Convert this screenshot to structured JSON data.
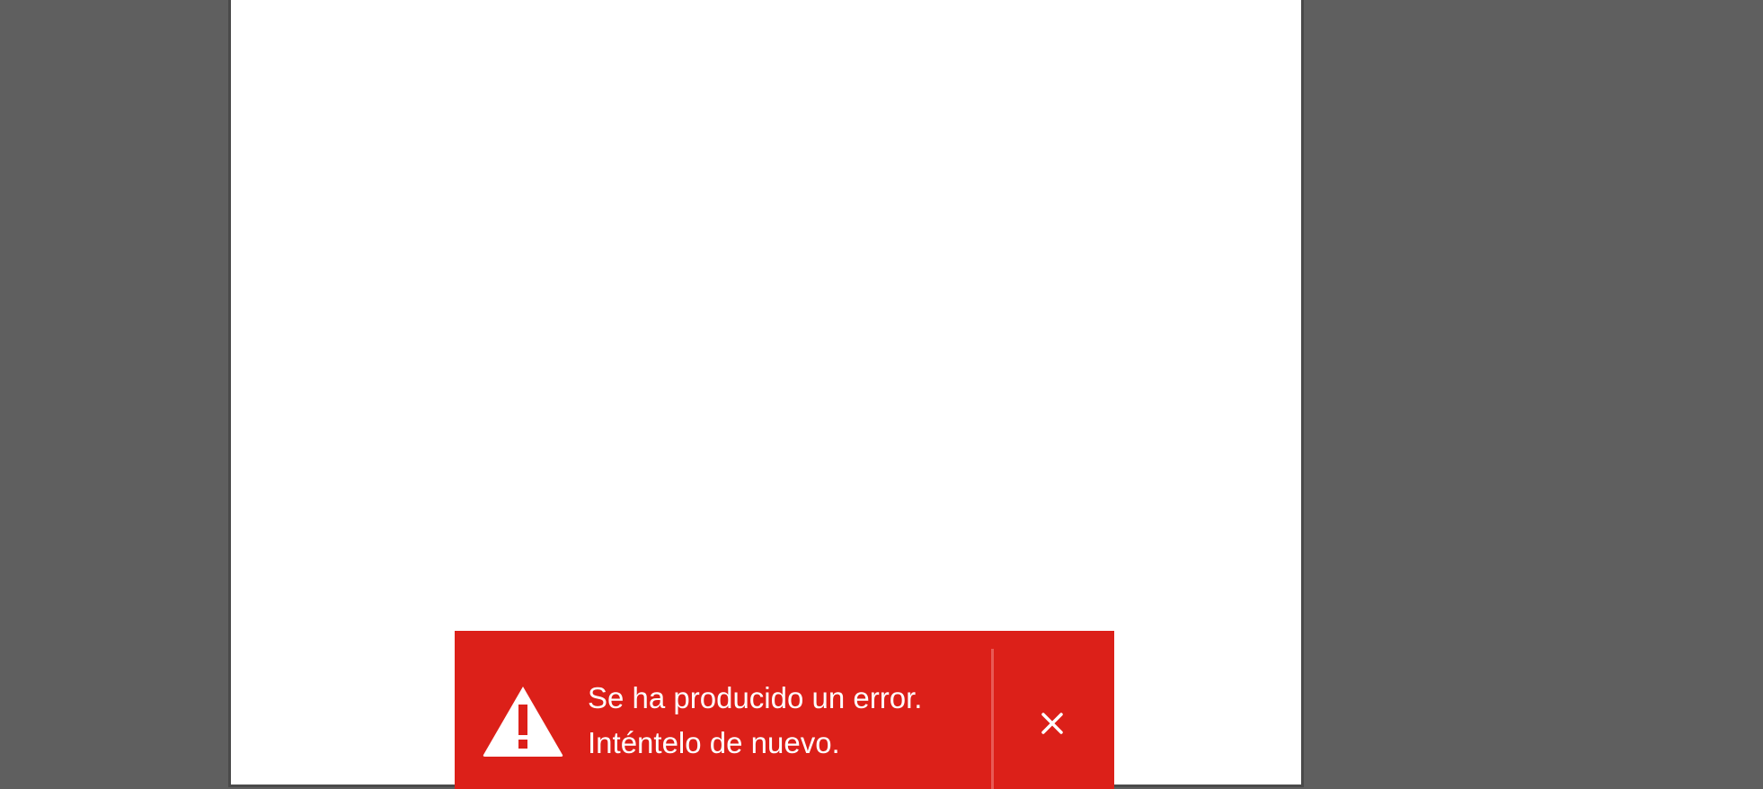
{
  "colors": {
    "viewer_background": "#5f5f5f",
    "page_background": "#ffffff",
    "toast_background": "#dc2019",
    "toast_text": "#ffffff"
  },
  "toast": {
    "icon": "warning-triangle-icon",
    "message_line1": "Se ha producido un error.",
    "message_line2": "Inténtelo de nuevo.",
    "close_icon": "close-icon"
  }
}
